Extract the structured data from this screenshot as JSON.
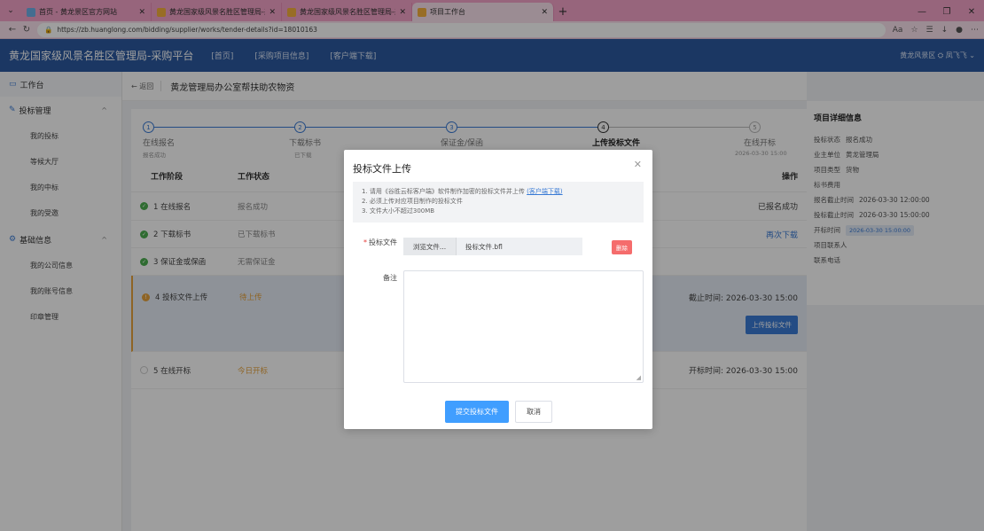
{
  "browser": {
    "tabs": [
      {
        "title": "首页 - 黄龙景区官方网站",
        "color": "#6fb0e8"
      },
      {
        "title": "黄龙国家级风景名胜区管理局-采购",
        "color": "#f5b13d"
      },
      {
        "title": "黄龙国家级风景名胜区管理局-采购",
        "color": "#f5b13d"
      },
      {
        "title": "项目工作台",
        "color": "#f5b13d"
      }
    ],
    "url": "https://zb.huanglong.com/bidding/supplier/works/tender-details?id=18010163"
  },
  "header": {
    "title": "黄龙国家级风景名胜区管理局-采购平台",
    "nav": [
      "[首页]",
      "[采购项目信息]",
      "[客户端下载]"
    ],
    "user": "黄龙风景区",
    "user_name": "凤飞飞"
  },
  "sidebar": {
    "workbench": "工作台",
    "groups": [
      {
        "label": "投标管理",
        "items": [
          "我的投标",
          "等候大厅",
          "我的中标",
          "我的受邀"
        ]
      },
      {
        "label": "基础信息",
        "items": [
          "我的公司信息",
          "我的账号信息",
          "印章管理"
        ]
      }
    ]
  },
  "breadcrumb": {
    "back": "返回",
    "title": "黄龙管理局办公室帮扶助农物资"
  },
  "steps": [
    {
      "num": "1",
      "name": "在线报名",
      "sub": "报名成功"
    },
    {
      "num": "2",
      "name": "下载标书",
      "sub": "已下载"
    },
    {
      "num": "3",
      "name": "保证金/保函",
      "sub": ""
    },
    {
      "num": "4",
      "name": "上传投标文件",
      "sub": ""
    },
    {
      "num": "5",
      "name": "在线开标",
      "sub": "2026-03-30 15:00"
    }
  ],
  "table": {
    "headers": {
      "stage": "工作阶段",
      "status": "工作状态",
      "op": "操作"
    },
    "rows": [
      {
        "stage": "1 在线报名",
        "status": "报名成功",
        "op": "已报名成功"
      },
      {
        "stage": "2 下载标书",
        "status": "已下载标书",
        "op": "再次下载"
      },
      {
        "stage": "3 保证金或保函",
        "status": "无需保证金",
        "op": ""
      },
      {
        "stage": "4 投标文件上传",
        "status": "待上传",
        "op": "截止时间: 2026-03-30 15:00",
        "btn": "上传投标文件"
      },
      {
        "stage": "5 在线开标",
        "status": "今日开标",
        "op": "开标时间: 2026-03-30 15:00"
      }
    ]
  },
  "details": {
    "title": "项目详细信息",
    "fields": [
      {
        "k": "投标状态",
        "v": "报名成功"
      },
      {
        "k": "业主单位",
        "v": "黄龙管理局"
      },
      {
        "k": "项目类型",
        "v": "货物"
      },
      {
        "k": "标书费用",
        "v": ""
      },
      {
        "k": "报名截止时间",
        "v": "2026-03-30 12:00:00"
      },
      {
        "k": "投标截止时间",
        "v": "2026-03-30 15:00:00"
      },
      {
        "k": "开标时间",
        "v": "2026-03-30 15:00:00"
      },
      {
        "k": "项目联系人",
        "v": ""
      },
      {
        "k": "联系电话",
        "v": ""
      }
    ]
  },
  "modal": {
    "title": "投标文件上传",
    "notice1_pre": "1. 请用《谷胜云标客户端》软件制作加密的投标文件并上传",
    "notice1_link": "(客户端下载)",
    "notice2": "2. 必须上传对应项目制作的投标文件",
    "notice3": "3. 文件大小不超过300MB",
    "file_label": "投标文件",
    "browse": "浏览文件...",
    "filename": "投标文件.bfl",
    "delete": "删除",
    "memo_label": "备注",
    "submit": "提交投标文件",
    "cancel": "取消"
  }
}
